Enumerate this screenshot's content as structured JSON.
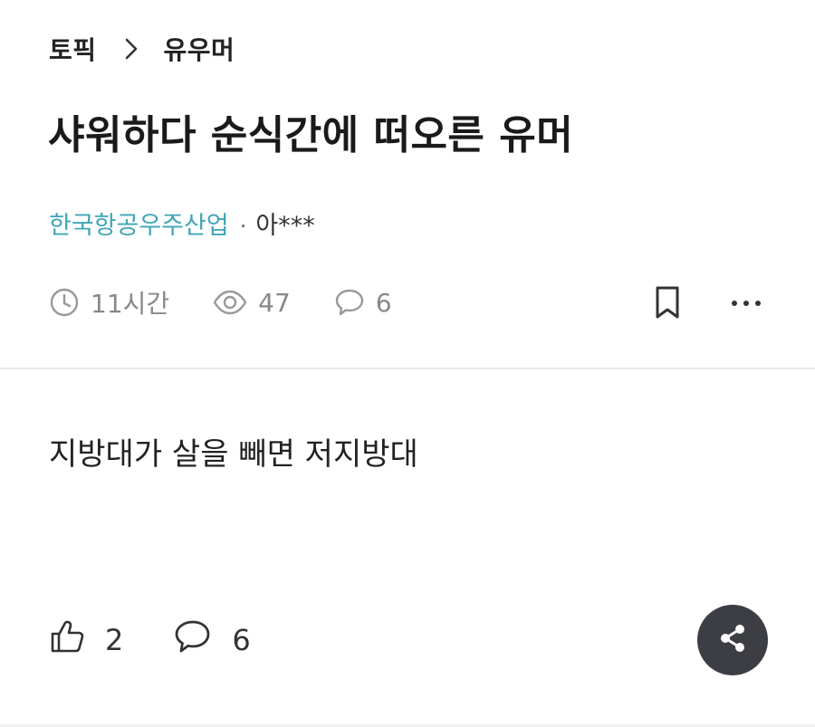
{
  "breadcrumb": {
    "root": "토픽",
    "current": "유우머"
  },
  "post": {
    "title": "샤워하다 순식간에 떠오른 유머",
    "company": "한국항공우주산업",
    "separator": "·",
    "nickname": "아***",
    "time": "11시간",
    "views": "47",
    "comments": "6",
    "body": "지방대가 살을 빼면 저지방대"
  },
  "footer": {
    "likes": "2",
    "comments": "6"
  },
  "colors": {
    "company": "#3fa5b4",
    "meta": "#888888",
    "fab": "#3d3e44"
  },
  "icons": {
    "separator": "chevron-right-icon",
    "time": "clock-icon",
    "views": "eye-icon",
    "comments": "speech-bubble-icon",
    "bookmark": "bookmark-icon",
    "more": "more-dots-icon",
    "like": "thumbs-up-icon",
    "share": "share-icon"
  }
}
